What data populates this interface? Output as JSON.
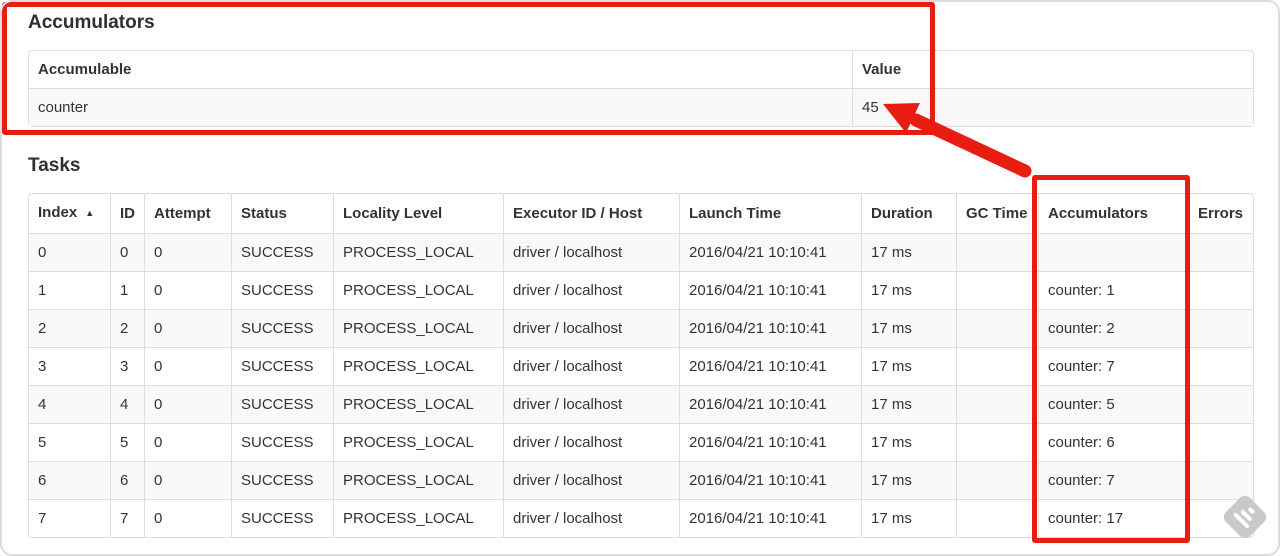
{
  "theme": {
    "annotation-red": "#e81c10",
    "row-stripe": "#f9f9f9",
    "table-border": "#dddddd",
    "text": "#333333",
    "frame-border": "#dcdcdc",
    "watermark-gray": "#c9c9c9"
  },
  "accumulators_section": {
    "title": "Accumulators",
    "table": {
      "headers": [
        "Accumulable",
        "Value"
      ],
      "rows": [
        [
          "counter",
          "45"
        ]
      ]
    }
  },
  "tasks_section": {
    "title": "Tasks",
    "table": {
      "headers": [
        "Index",
        "ID",
        "Attempt",
        "Status",
        "Locality Level",
        "Executor ID / Host",
        "Launch Time",
        "Duration",
        "GC Time",
        "Accumulators",
        "Errors"
      ],
      "sort_icon": "▲",
      "rows": [
        [
          "0",
          "0",
          "0",
          "SUCCESS",
          "PROCESS_LOCAL",
          "driver / localhost",
          "2016/04/21 10:10:41",
          "17 ms",
          "",
          "",
          ""
        ],
        [
          "1",
          "1",
          "0",
          "SUCCESS",
          "PROCESS_LOCAL",
          "driver / localhost",
          "2016/04/21 10:10:41",
          "17 ms",
          "",
          "counter: 1",
          ""
        ],
        [
          "2",
          "2",
          "0",
          "SUCCESS",
          "PROCESS_LOCAL",
          "driver / localhost",
          "2016/04/21 10:10:41",
          "17 ms",
          "",
          "counter: 2",
          ""
        ],
        [
          "3",
          "3",
          "0",
          "SUCCESS",
          "PROCESS_LOCAL",
          "driver / localhost",
          "2016/04/21 10:10:41",
          "17 ms",
          "",
          "counter: 7",
          ""
        ],
        [
          "4",
          "4",
          "0",
          "SUCCESS",
          "PROCESS_LOCAL",
          "driver / localhost",
          "2016/04/21 10:10:41",
          "17 ms",
          "",
          "counter: 5",
          ""
        ],
        [
          "5",
          "5",
          "0",
          "SUCCESS",
          "PROCESS_LOCAL",
          "driver / localhost",
          "2016/04/21 10:10:41",
          "17 ms",
          "",
          "counter: 6",
          ""
        ],
        [
          "6",
          "6",
          "0",
          "SUCCESS",
          "PROCESS_LOCAL",
          "driver / localhost",
          "2016/04/21 10:10:41",
          "17 ms",
          "",
          "counter: 7",
          ""
        ],
        [
          "7",
          "7",
          "0",
          "SUCCESS",
          "PROCESS_LOCAL",
          "driver / localhost",
          "2016/04/21 10:10:41",
          "17 ms",
          "",
          "counter: 17",
          ""
        ]
      ]
    }
  },
  "annotations": {
    "color": "#e81c10",
    "boxes": [
      "accumulators-summary-section",
      "accumulators-task-column"
    ],
    "arrow_meaning": "points from task accumulators column to total value 45"
  }
}
